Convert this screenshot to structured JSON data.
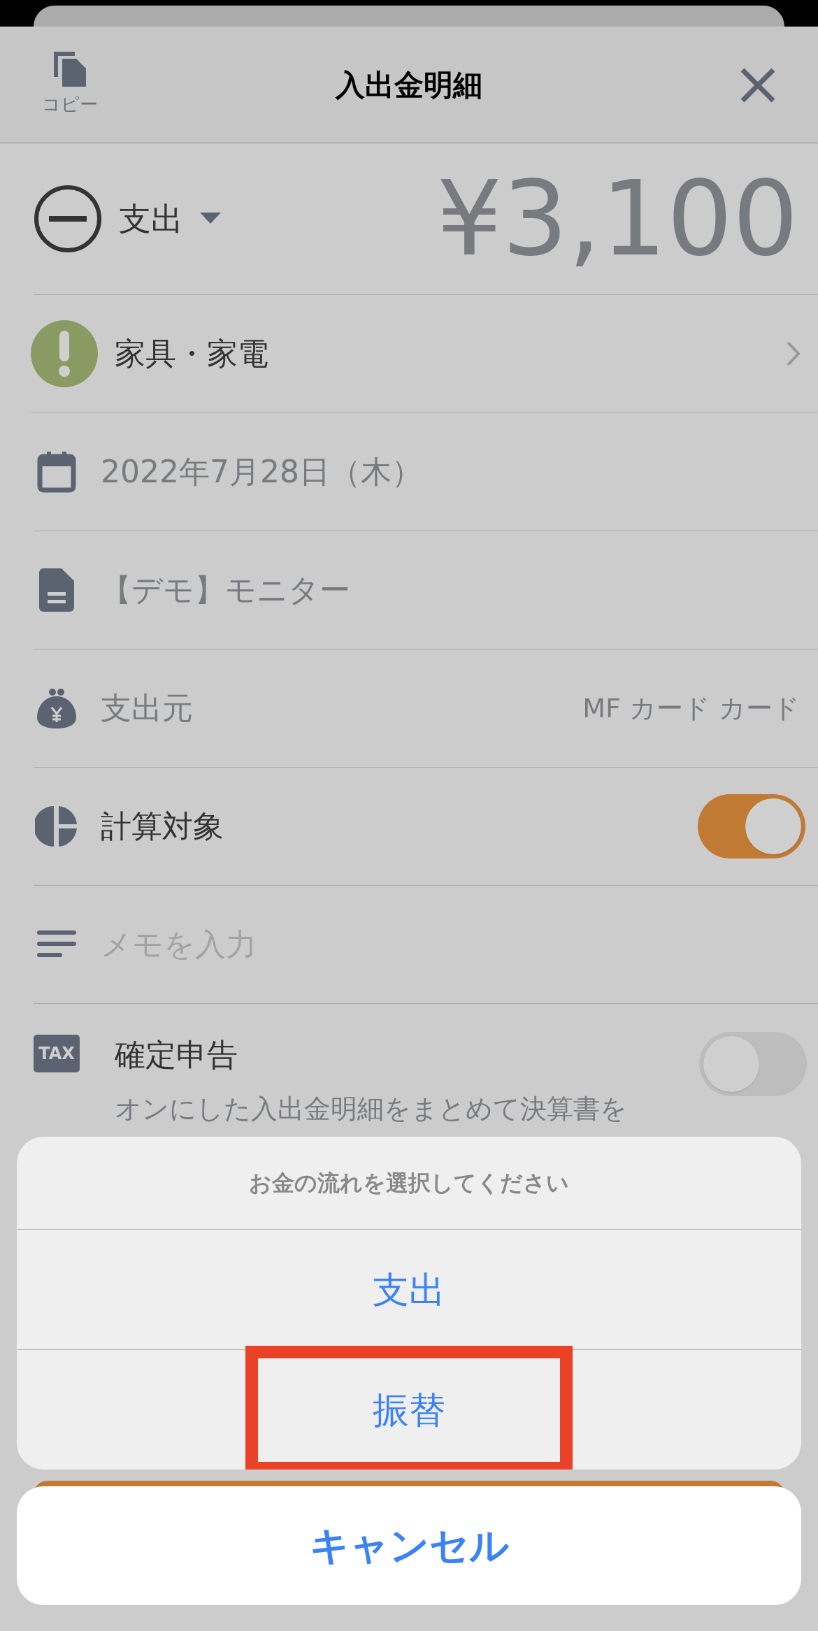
{
  "header": {
    "copy_label": "コピー",
    "title": "入出金明細"
  },
  "amount_row": {
    "type_label": "支出",
    "amount": "¥3,100"
  },
  "rows": [
    {
      "kind": "category",
      "label": "家具・家電"
    },
    {
      "kind": "date",
      "label": "2022年7月28日（木）"
    },
    {
      "kind": "content",
      "label": "【デモ】モニター"
    },
    {
      "kind": "source",
      "label": "支出元",
      "value": "MF カード カード"
    },
    {
      "kind": "toggle",
      "label": "計算対象",
      "on": true
    },
    {
      "kind": "memo",
      "placeholder": "メモを入力"
    },
    {
      "kind": "tax",
      "badge": "TAX",
      "label": "確定申告",
      "on": false,
      "description": "オンにした入出金明細をまとめて決算書を"
    }
  ],
  "action_sheet": {
    "title": "お金の流れを選択してください",
    "options": [
      {
        "label": "支出",
        "highlighted": false
      },
      {
        "label": "振替",
        "highlighted": true
      }
    ],
    "cancel": "キャンセル"
  }
}
